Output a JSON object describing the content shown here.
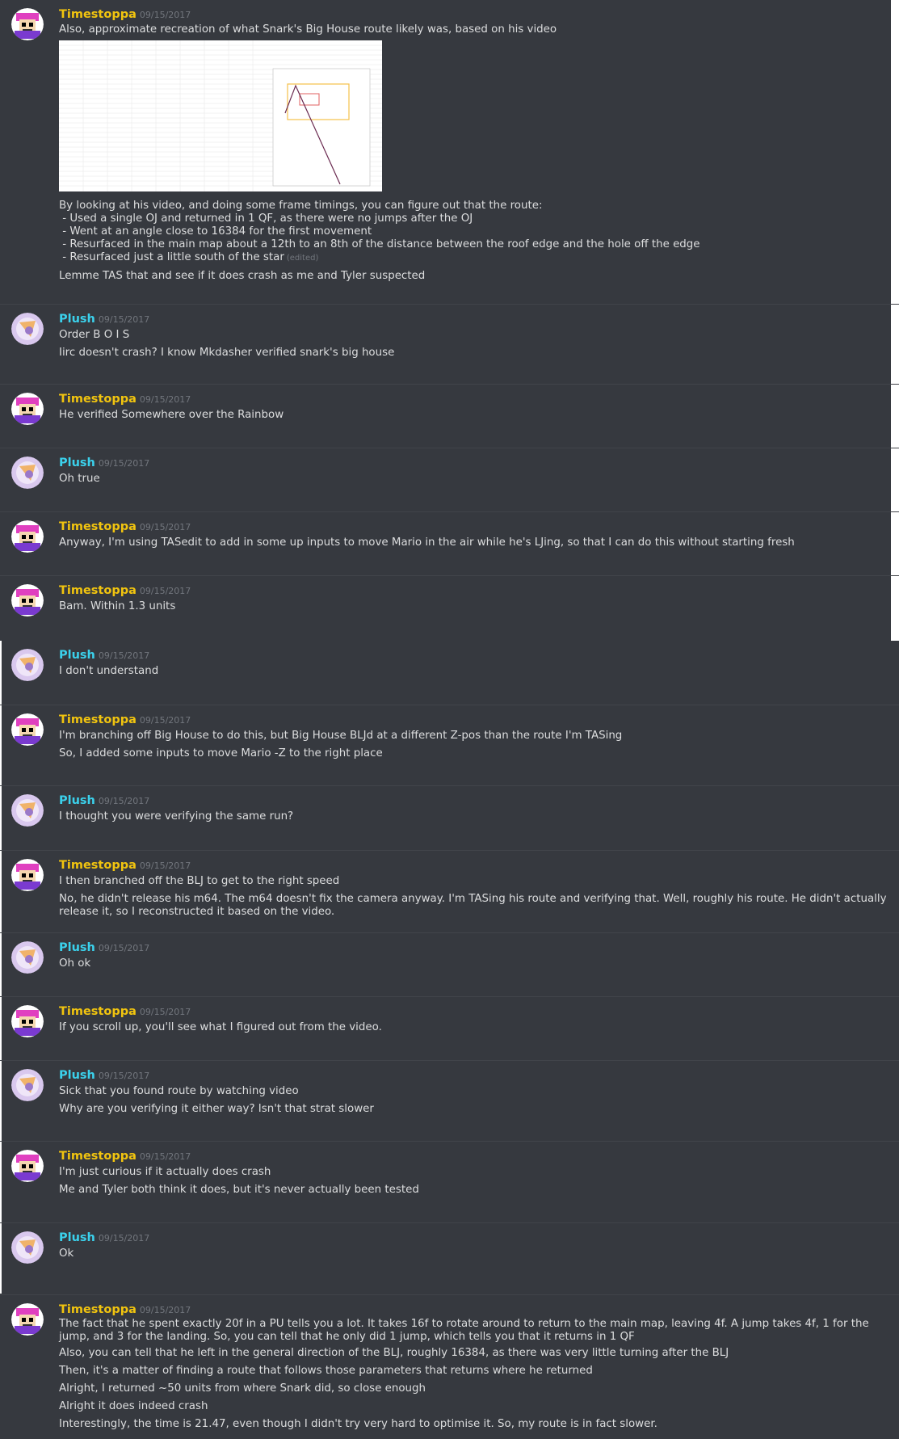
{
  "authors": {
    "t": "Timestoppa",
    "p": "Plush"
  },
  "messages": [
    {
      "author": "Timestoppa",
      "timestamp": "09/15/2017",
      "lines": [
        "Also, approximate recreation of what Snark's Big House route likely was, based on his video"
      ],
      "attachment": "spreadsheet-image",
      "lines_after": [
        "By looking at his video, and doing some frame timings, you can figure out that the route:\n - Used a single OJ and returned in 1 QF, as there were no jumps after the OJ\n - Went at an angle close to 16384 for the first movement\n - Resurfaced in the main map about a 12th to an 8th of the distance between the roof edge and the hole off the edge\n - Resurfaced just a little south of the star",
        "Lemme TAS that and see if it does crash as me and Tyler suspected"
      ],
      "edited_label": "(edited)"
    },
    {
      "author": "Plush",
      "timestamp": "09/15/2017",
      "lines": [
        "Order B O I S",
        "Iirc doesn't crash? I know Mkdasher verified snark's big house"
      ]
    },
    {
      "author": "Timestoppa",
      "timestamp": "09/15/2017",
      "lines": [
        "He verified Somewhere over the Rainbow"
      ]
    },
    {
      "author": "Plush",
      "timestamp": "09/15/2017",
      "lines": [
        "Oh true"
      ]
    },
    {
      "author": "Timestoppa",
      "timestamp": "09/15/2017",
      "lines": [
        "Anyway, I'm using TASedit to add in some up inputs to move Mario in the air while he's LJing, so that I can do this without starting fresh"
      ]
    },
    {
      "author": "Timestoppa",
      "timestamp": "09/15/2017",
      "lines": [
        "Bam. Within 1.3 units"
      ]
    },
    {
      "author": "Plush",
      "timestamp": "09/15/2017",
      "lines": [
        "I don't understand"
      ]
    },
    {
      "author": "Timestoppa",
      "timestamp": "09/15/2017",
      "lines": [
        "I'm branching off Big House to do this, but Big House BLJd at a different Z-pos than the route I'm TASing",
        "So, I added some inputs to move Mario -Z to the right place"
      ]
    },
    {
      "author": "Plush",
      "timestamp": "09/15/2017",
      "lines": [
        "I thought you were verifying the same run?"
      ]
    },
    {
      "author": "Timestoppa",
      "timestamp": "09/15/2017",
      "lines": [
        "I then branched off the BLJ to get to the right speed",
        "No, he didn't release his m64. The m64 doesn't fix the camera anyway. I'm TASing his route and verifying that. Well, roughly his route. He didn't actually release it, so I reconstructed it based on the video."
      ]
    },
    {
      "author": "Plush",
      "timestamp": "09/15/2017",
      "lines": [
        "Oh ok"
      ]
    },
    {
      "author": "Timestoppa",
      "timestamp": "09/15/2017",
      "lines": [
        "If you scroll up, you'll see what I figured out from the video."
      ]
    },
    {
      "author": "Plush",
      "timestamp": "09/15/2017",
      "lines": [
        "Sick that you found route by watching video",
        "Why are you verifying it either way? Isn't that strat slower"
      ]
    },
    {
      "author": "Timestoppa",
      "timestamp": "09/15/2017",
      "lines": [
        "I'm just curious if it actually does crash",
        "Me and Tyler both think it does, but it's never actually been tested"
      ]
    },
    {
      "author": "Plush",
      "timestamp": "09/15/2017",
      "lines": [
        "Ok"
      ]
    },
    {
      "author": "Timestoppa",
      "timestamp": "09/15/2017",
      "lines": [
        "The fact that he spent exactly 20f in a PU tells you a lot. It takes 16f to rotate around to return to the main map, leaving 4f. A jump takes 4f, 1 for the jump, and 3 for the landing. So, you can tell that he only did 1 jump, which tells you that it returns in 1 QF",
        "Also, you can tell that he left in the general direction of the BLJ, roughly 16384, as there was very little turning after the BLJ",
        "Then, it's a matter of finding a route that follows those parameters that returns where he returned",
        "Alright, I returned ~50 units from where Snark did, so close enough",
        "Alright it does indeed crash",
        "Interestingly, the time is 21.47, even though I didn't try very hard to optimise it. So, my route is in fact slower."
      ]
    }
  ]
}
